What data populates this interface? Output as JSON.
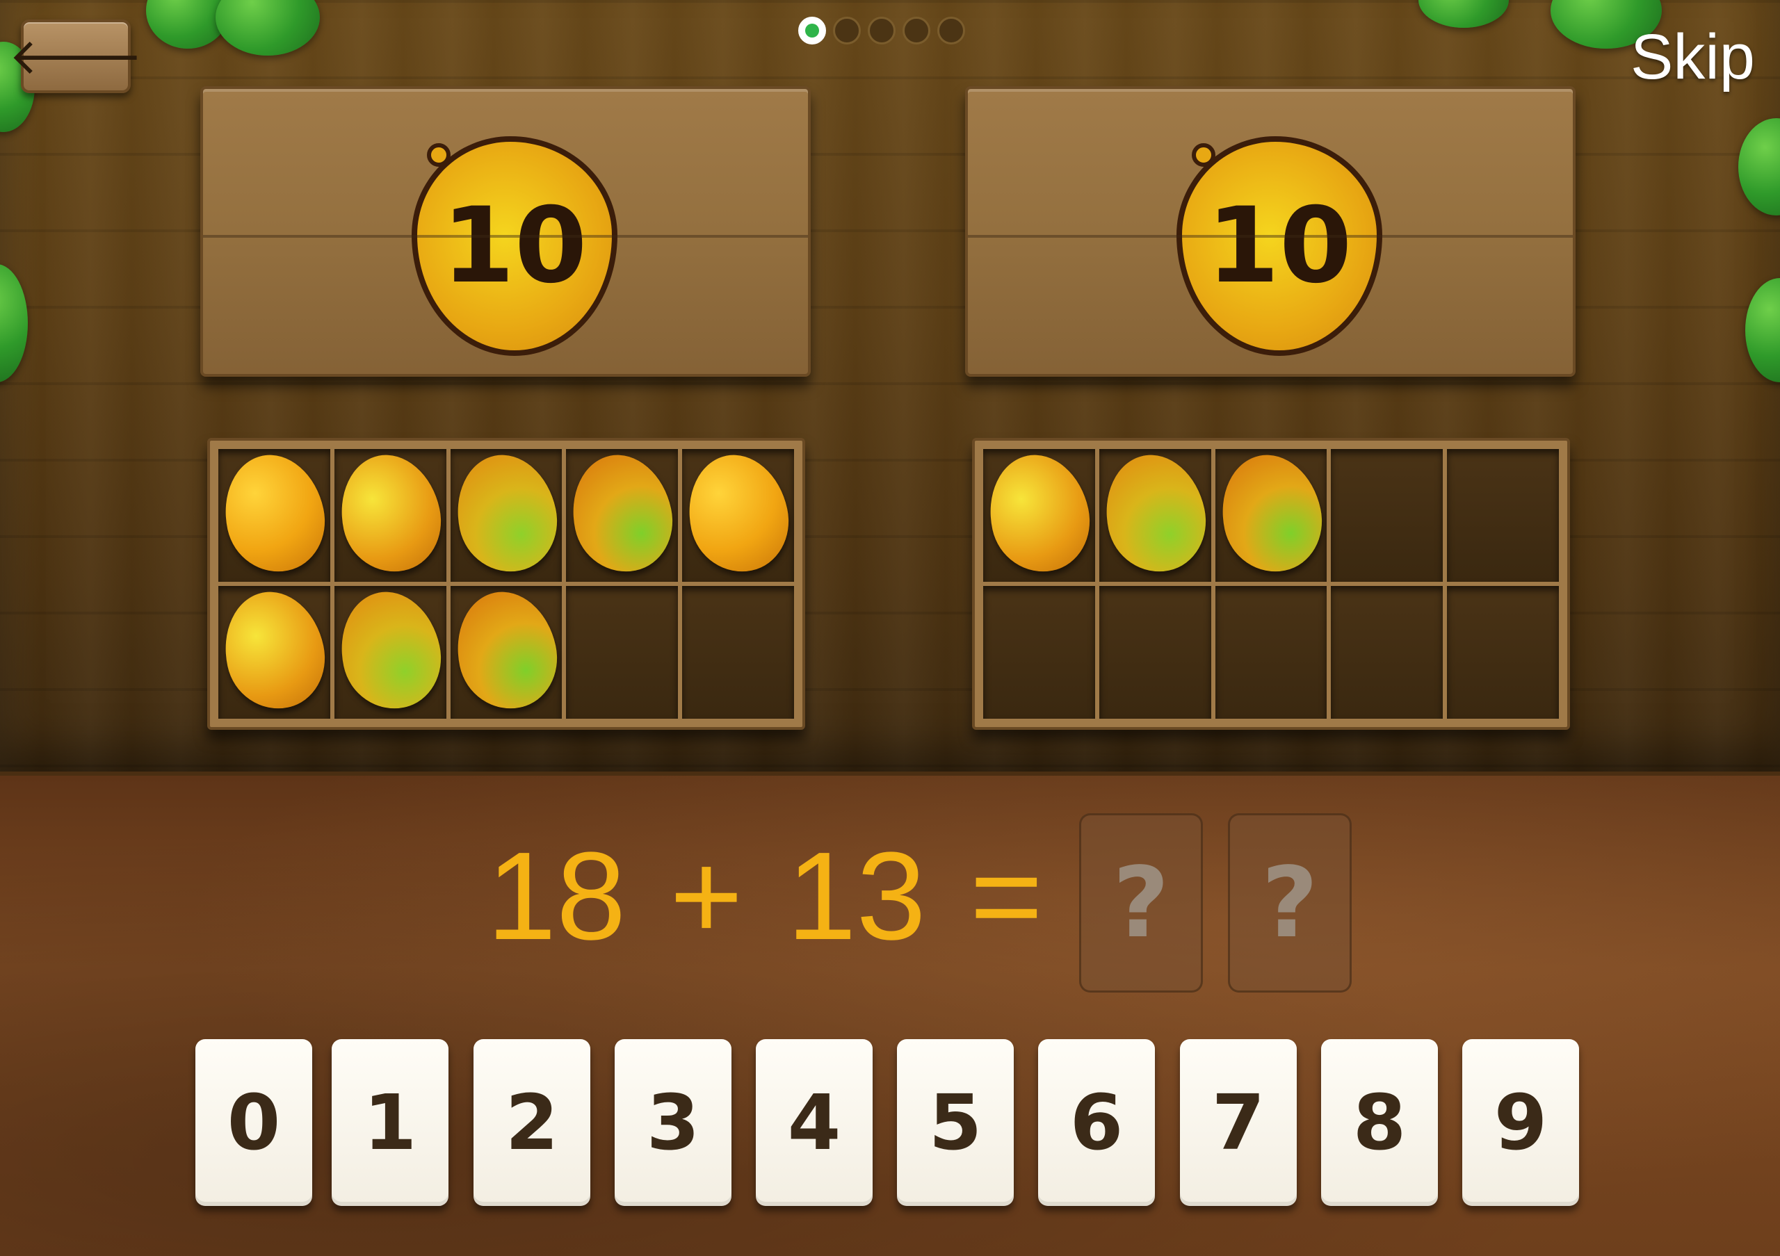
{
  "topbar": {
    "back_icon": "left-arrow-icon",
    "back_glyph": "🡐",
    "skip_label": "Skip",
    "progress_total": 5,
    "progress_current": 1
  },
  "crates": [
    {
      "badge_value": "10"
    },
    {
      "badge_value": "10"
    }
  ],
  "trays": [
    {
      "filled_cells": 8,
      "capacity": 10
    },
    {
      "filled_cells": 3,
      "capacity": 10
    }
  ],
  "equation": {
    "operand_a": "18",
    "operator": "+",
    "operand_b": "13",
    "equals": "=",
    "answer_placeholders": [
      "?",
      "?"
    ]
  },
  "keypad": {
    "keys": [
      "0",
      "1",
      "2",
      "3",
      "4",
      "5",
      "6",
      "7",
      "8",
      "9"
    ]
  },
  "colors": {
    "equation_text": "#f5b214",
    "progress_active": "#2fb44a",
    "skip_text": "#ffffff"
  }
}
